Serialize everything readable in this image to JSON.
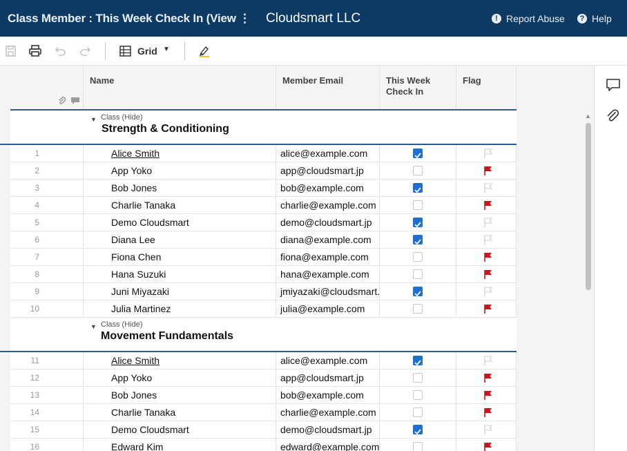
{
  "header": {
    "title": "Class Member : This Week Check In (View Only)",
    "more": "⋮",
    "org": "Cloudsmart LLC",
    "report_abuse": "Report Abuse",
    "help": "Help"
  },
  "toolbar": {
    "view_label": "Grid"
  },
  "columns": {
    "name": "Name",
    "email": "Member Email",
    "check_in": "This Week Check In",
    "flag": "Flag"
  },
  "groups": [
    {
      "sub": "Class (Hide)",
      "name": "Strength & Conditioning",
      "rows": [
        {
          "num": "1",
          "name": "Alice Smith",
          "email": "alice@example.com",
          "checked": true,
          "flagged": false,
          "linked": true
        },
        {
          "num": "2",
          "name": "App Yoko",
          "email": "app@cloudsmart.jp",
          "checked": false,
          "flagged": true,
          "linked": false
        },
        {
          "num": "3",
          "name": "Bob Jones",
          "email": "bob@example.com",
          "checked": true,
          "flagged": false,
          "linked": false
        },
        {
          "num": "4",
          "name": "Charlie Tanaka",
          "email": "charlie@example.com",
          "checked": false,
          "flagged": true,
          "linked": false
        },
        {
          "num": "5",
          "name": "Demo Cloudsmart",
          "email": "demo@cloudsmart.jp",
          "checked": true,
          "flagged": false,
          "linked": false
        },
        {
          "num": "6",
          "name": "Diana Lee",
          "email": "diana@example.com",
          "checked": true,
          "flagged": false,
          "linked": false
        },
        {
          "num": "7",
          "name": "Fiona Chen",
          "email": "fiona@example.com",
          "checked": false,
          "flagged": true,
          "linked": false
        },
        {
          "num": "8",
          "name": "Hana Suzuki",
          "email": "hana@example.com",
          "checked": false,
          "flagged": true,
          "linked": false
        },
        {
          "num": "9",
          "name": "Juni Miyazaki",
          "email": "jmiyazaki@cloudsmart.",
          "checked": true,
          "flagged": false,
          "linked": false
        },
        {
          "num": "10",
          "name": "Julia Martinez",
          "email": "julia@example.com",
          "checked": false,
          "flagged": true,
          "linked": false
        }
      ]
    },
    {
      "sub": "Class (Hide)",
      "name": "Movement Fundamentals",
      "rows": [
        {
          "num": "11",
          "name": "Alice Smith",
          "email": "alice@example.com",
          "checked": true,
          "flagged": false,
          "linked": true
        },
        {
          "num": "12",
          "name": "App Yoko",
          "email": "app@cloudsmart.jp",
          "checked": false,
          "flagged": true,
          "linked": false
        },
        {
          "num": "13",
          "name": "Bob Jones",
          "email": "bob@example.com",
          "checked": false,
          "flagged": true,
          "linked": false
        },
        {
          "num": "14",
          "name": "Charlie Tanaka",
          "email": "charlie@example.com",
          "checked": false,
          "flagged": true,
          "linked": false
        },
        {
          "num": "15",
          "name": "Demo Cloudsmart",
          "email": "demo@cloudsmart.jp",
          "checked": true,
          "flagged": false,
          "linked": false
        },
        {
          "num": "16",
          "name": "Edward Kim",
          "email": "edward@example.com",
          "checked": false,
          "flagged": true,
          "linked": false
        }
      ]
    }
  ],
  "colors": {
    "header_bg": "#0d3a63",
    "check_on": "#1f6fd1",
    "flag_on": "#d0121b",
    "flag_off": "#cfcfcf",
    "group_line": "#2d5a8a"
  },
  "icons": {
    "save": "save-icon",
    "print": "print-icon",
    "undo": "undo-icon",
    "redo": "redo-icon",
    "grid": "grid-icon",
    "highlight": "highlight-icon",
    "comments": "comment-icon",
    "attachments": "paperclip-icon"
  }
}
